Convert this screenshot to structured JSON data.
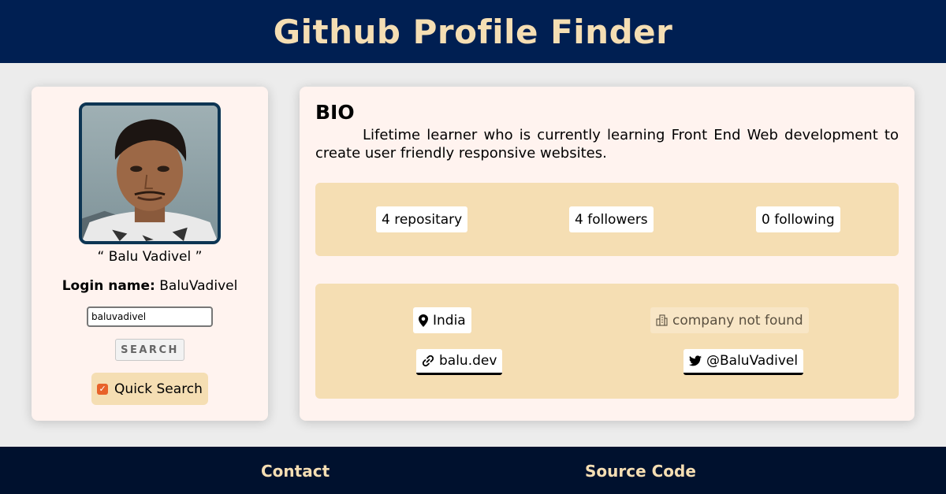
{
  "header": {
    "title": "Github Profile Finder"
  },
  "profile": {
    "name": "“ Balu Vadivel ”",
    "login_label": "Login name:",
    "login_value": "BaluVadivel",
    "search_value": "baluvadivel",
    "search_button": "SEARCH",
    "quick_search_label": "Quick Search",
    "quick_search_checked": true
  },
  "info": {
    "bio_title": "BIO",
    "bio_text": "Lifetime learner who is currently learning Front End Web development to create user friendly responsive websites.",
    "stats": {
      "repositories": "4 repositary",
      "followers": "4 followers",
      "following": "0 following"
    },
    "meta": {
      "location": "India",
      "company": "company not found",
      "website": "balu.dev",
      "twitter": "@BaluVadivel"
    },
    "icons": {
      "location": "map-pin-icon",
      "company": "building-icon",
      "website": "link-icon",
      "twitter": "twitter-icon"
    }
  },
  "footer": {
    "contact": "Contact",
    "source_code": "Source Code"
  },
  "colors": {
    "header_bg": "#001f52",
    "footer_bg": "#00112e",
    "accent": "#f5deb3",
    "card_bg": "#fff3ef",
    "checkbox": "#e8622a"
  }
}
